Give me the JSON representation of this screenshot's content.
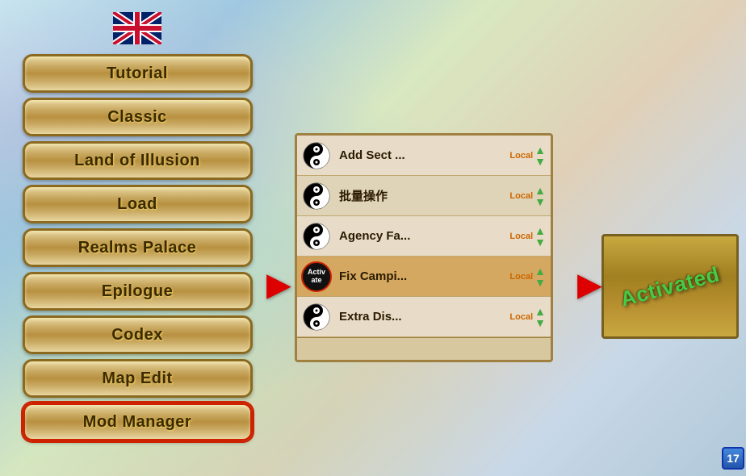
{
  "background": {
    "color": "#b8d4e8"
  },
  "flag": {
    "alt": "UK Flag"
  },
  "menu": {
    "items": [
      {
        "label": "Tutorial",
        "active": false
      },
      {
        "label": "Classic",
        "active": false
      },
      {
        "label": "Land of Illusion",
        "active": false
      },
      {
        "label": "Load",
        "active": false
      },
      {
        "label": "Realms Palace",
        "active": false
      },
      {
        "label": "Epilogue",
        "active": false
      },
      {
        "label": "Codex",
        "active": false
      },
      {
        "label": "Map Edit",
        "active": false
      },
      {
        "label": "Mod Manager",
        "active": true
      }
    ]
  },
  "arrows": {
    "left": "▶",
    "right": "▶"
  },
  "mod_list": {
    "rows": [
      {
        "name": "Add Sect ...",
        "tag": "Local",
        "icon": "yinyang",
        "highlighted": false
      },
      {
        "name": "批量操作",
        "tag": "Local",
        "icon": "yinyang",
        "highlighted": false
      },
      {
        "name": "Agency Fa...",
        "tag": "Local",
        "icon": "yinyang",
        "highlighted": false
      },
      {
        "name": "Fix Campi...",
        "tag": "Local",
        "icon": "activate",
        "highlighted": true
      },
      {
        "name": "Extra Dis...",
        "tag": "Local",
        "icon": "yinyang",
        "highlighted": false
      }
    ]
  },
  "activated": {
    "text": "Activated"
  },
  "badge": {
    "number": "17"
  }
}
